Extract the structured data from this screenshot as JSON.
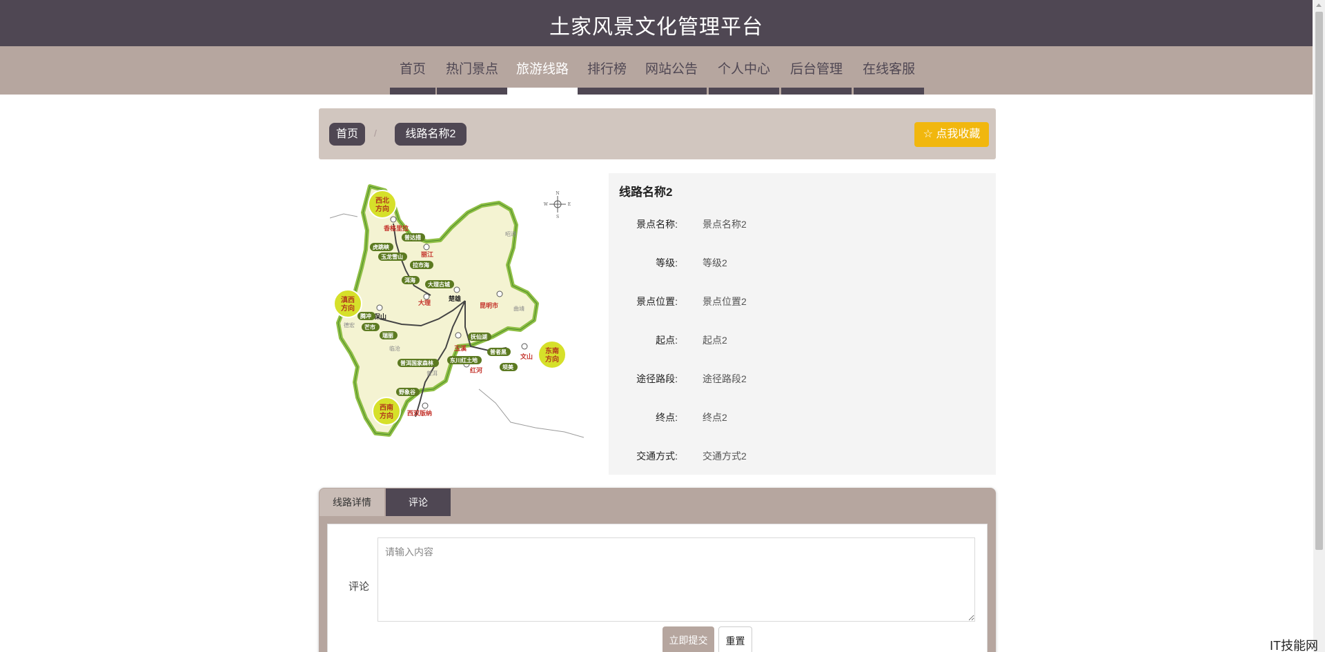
{
  "header": {
    "title": "土家风景文化管理平台"
  },
  "nav": {
    "items": [
      {
        "label": "首页",
        "active": false
      },
      {
        "label": "热门景点",
        "active": false
      },
      {
        "label": "旅游线路",
        "active": true
      },
      {
        "label": "排行榜",
        "active": false
      },
      {
        "label": "网站公告",
        "active": false
      },
      {
        "label": "个人中心",
        "active": false
      },
      {
        "label": "后台管理",
        "active": false
      },
      {
        "label": "在线客服",
        "active": false
      }
    ]
  },
  "breadcrumb": {
    "home": "首页",
    "separator": "/",
    "current": "线路名称2"
  },
  "favorite": {
    "label": "☆ 点我收藏"
  },
  "map": {
    "compass": {
      "n": "N",
      "s": "S",
      "w": "W",
      "e": "E"
    },
    "directions": [
      "西北方向",
      "滇西方向",
      "东南方向",
      "西南方向"
    ],
    "red_cities": [
      "香格里拉",
      "丽江",
      "大理",
      "昆明市",
      "玉溪",
      "文山",
      "红河",
      "西双版纳"
    ],
    "black_cities": [
      "保山",
      "楚雄"
    ],
    "gray_cities": [
      "昭通",
      "曲靖",
      "德宏",
      "临沧",
      "普洱"
    ],
    "tags": [
      "普达措",
      "虎跳峡",
      "玉龙雪山",
      "拉市海",
      "洱海",
      "大理古城",
      "腾冲",
      "芒市",
      "瑞丽",
      "抚仙湖",
      "普者黑",
      "东川红土地",
      "坝美",
      "普洱国家森林",
      "野象谷"
    ]
  },
  "info": {
    "title": "线路名称2",
    "rows": [
      {
        "label": "景点名称:",
        "value": "景点名称2"
      },
      {
        "label": "等级:",
        "value": "等级2"
      },
      {
        "label": "景点位置:",
        "value": "景点位置2"
      },
      {
        "label": "起点:",
        "value": "起点2"
      },
      {
        "label": "途径路段:",
        "value": "途径路段2"
      },
      {
        "label": "终点:",
        "value": "终点2"
      },
      {
        "label": "交通方式:",
        "value": "交通方式2"
      }
    ]
  },
  "tabs": {
    "detail": "线路详情",
    "comment": "评论"
  },
  "comment_form": {
    "label": "评论",
    "placeholder": "请输入内容",
    "submit": "立即提交",
    "reset": "重置"
  },
  "watermark": "IT技能网",
  "colors": {
    "header": "#4f4753",
    "nav": "#b6a69f",
    "breadcrumb_bar": "#d1c6bf",
    "favorite": "#f1b70e",
    "panel": "#f4f4f4"
  }
}
